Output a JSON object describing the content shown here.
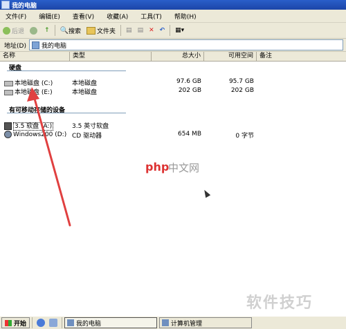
{
  "window": {
    "title": "我的电脑"
  },
  "menu": [
    "文件(F)",
    "编辑(E)",
    "查看(V)",
    "收藏(A)",
    "工具(T)",
    "帮助(H)"
  ],
  "toolbar": {
    "back": "后退",
    "search": "搜索",
    "folders": "文件夹"
  },
  "address": {
    "label": "地址(D)",
    "value": "我的电脑"
  },
  "columns": [
    "名称",
    "类型",
    "总大小",
    "可用空间",
    "备注"
  ],
  "groups": {
    "hard_disks": "硬盘",
    "removable": "有可移动存储的设备"
  },
  "drives": [
    {
      "name": "本地磁盘 (C:)",
      "type": "本地磁盘",
      "total": "97.6 GB",
      "free": "95.7 GB"
    },
    {
      "name": "本地磁盘 (E:)",
      "type": "本地磁盘",
      "total": "202 GB",
      "free": "202 GB"
    }
  ],
  "removable": [
    {
      "name": "3.5 软盘 (A:)",
      "type": "3.5 英寸软盘",
      "total": "",
      "free": ""
    },
    {
      "name": "Windows200 (D:)",
      "type": "CD 驱动器",
      "total": "654 MB",
      "free": "0 字节"
    }
  ],
  "watermark": {
    "php_logo": "php",
    "php_text": "中文网",
    "corner": "软件技巧"
  },
  "taskbar": {
    "start": "开始",
    "tasks": [
      "我的电脑",
      "计算机管理"
    ]
  },
  "colors": {
    "titlebar": "#1b45a8",
    "arrow": "#e04040"
  }
}
